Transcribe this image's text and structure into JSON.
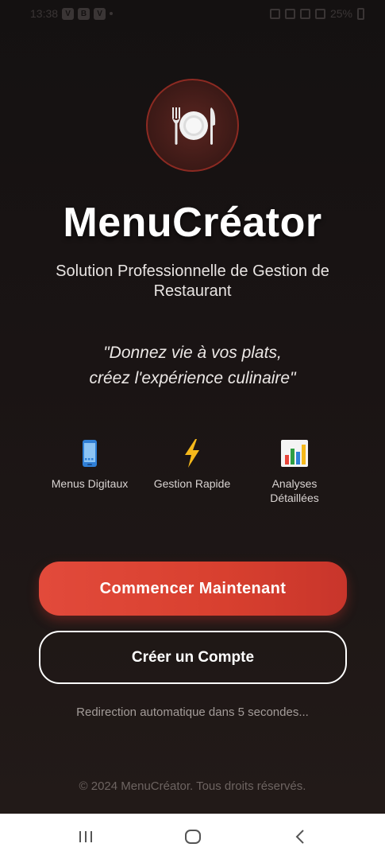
{
  "status_bar": {
    "time": "13:38",
    "app_icons": [
      "V",
      "B",
      "V"
    ],
    "battery": "25%"
  },
  "app": {
    "title": "MenuCréator",
    "subtitle": "Solution Professionnelle de Gestion de Restaurant",
    "tagline_line1": "\"Donnez vie à vos plats,",
    "tagline_line2": "créez l'expérience culinaire\""
  },
  "features": [
    {
      "icon": "phone-icon",
      "label": "Menus Digitaux"
    },
    {
      "icon": "lightning-icon",
      "label": "Gestion Rapide"
    },
    {
      "icon": "bar-chart-icon",
      "label_line1": "Analyses",
      "label_line2": "Détaillées"
    }
  ],
  "actions": {
    "primary_label": "Commencer Maintenant",
    "secondary_label": "Créer un Compte"
  },
  "redirect_text": "Redirection automatique dans 5 secondes...",
  "copyright": "© 2024 MenuCréator. Tous droits réservés.",
  "colors": {
    "background": "#141111",
    "accent": "#e24a3b",
    "logo_ring": "#8c2a22"
  }
}
